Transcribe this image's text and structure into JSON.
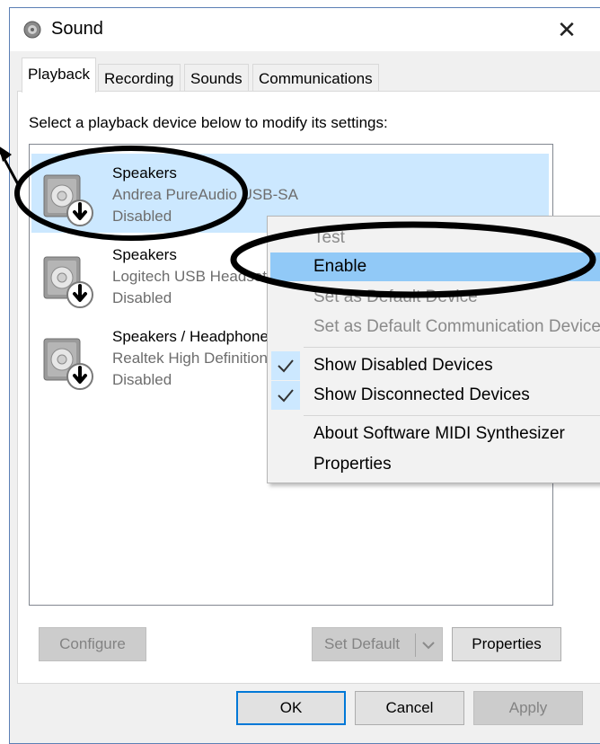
{
  "window": {
    "title": "Sound",
    "close_glyph": "✕"
  },
  "tabs": [
    {
      "label": "Playback",
      "active": true
    },
    {
      "label": "Recording",
      "active": false
    },
    {
      "label": "Sounds",
      "active": false
    },
    {
      "label": "Communications",
      "active": false
    }
  ],
  "instruction": "Select a playback device below to modify its settings:",
  "devices": [
    {
      "name": "Speakers",
      "description": "Andrea PureAudio USB-SA",
      "status": "Disabled",
      "selected": true,
      "icon": "speaker-disabled-icon"
    },
    {
      "name": "Speakers",
      "description": "Logitech USB Headset",
      "status": "Disabled",
      "selected": false,
      "icon": "speaker-disabled-icon"
    },
    {
      "name": "Speakers / Headphones",
      "description": "Realtek High Definition Audio",
      "status": "Disabled",
      "selected": false,
      "icon": "speaker-disabled-icon"
    }
  ],
  "context_menu": {
    "items": [
      {
        "label": "Test",
        "enabled": false
      },
      {
        "label": "Enable",
        "enabled": true,
        "highlighted": true
      },
      {
        "label": "Set as Default Device",
        "enabled": false
      },
      {
        "label": "Set as Default Communication Device",
        "enabled": false
      },
      {
        "label": "Show Disabled Devices",
        "enabled": true,
        "checked": true
      },
      {
        "label": "Show Disconnected Devices",
        "enabled": true,
        "checked": true
      },
      {
        "label": "About Software MIDI Synthesizer",
        "enabled": true
      },
      {
        "label": "Properties",
        "enabled": true
      }
    ]
  },
  "buttons": {
    "configure": "Configure",
    "set_default": "Set Default",
    "properties": "Properties",
    "ok": "OK",
    "cancel": "Cancel",
    "apply": "Apply"
  },
  "colors": {
    "selection": "#cce8ff",
    "menu_highlight": "#91c9f7",
    "accent": "#0078d7",
    "annotation": "#000000"
  }
}
